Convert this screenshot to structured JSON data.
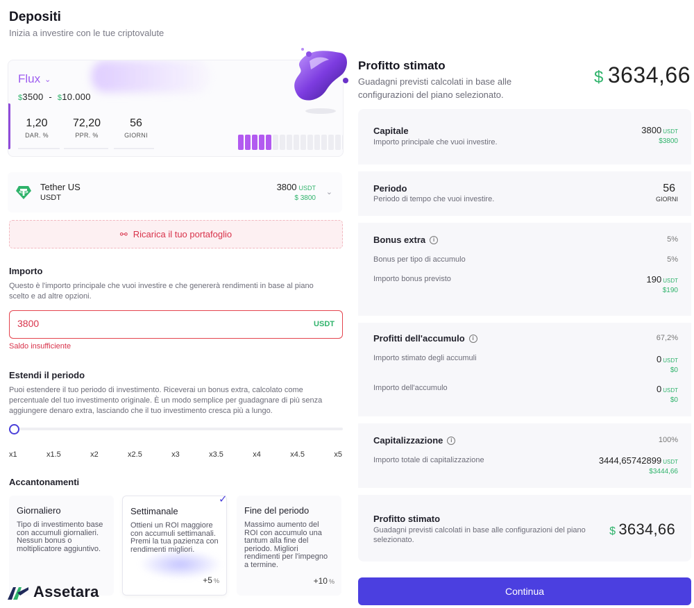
{
  "header": {
    "title": "Depositi",
    "subtitle": "Inizia a investire con le tue criptovalute"
  },
  "plan": {
    "name": "Flux",
    "range_min_currency": "$",
    "range_min": "3500",
    "range_sep": "-",
    "range_max_currency": "$",
    "range_max": "10.000",
    "stats": [
      {
        "value": "1,20",
        "label": "DAR. %"
      },
      {
        "value": "72,20",
        "label": "PPR. %"
      },
      {
        "value": "56",
        "label": "GIORNI"
      }
    ],
    "level_filled": 5,
    "level_total": 16,
    "accent_color": "#b25af0"
  },
  "wallet": {
    "name": "Tether US",
    "symbol": "USDT",
    "amount": "3800",
    "amount_unit": "USDT",
    "amount_usd": "$ 3800"
  },
  "alert": {
    "label": "Ricarica il tuo portafoglio",
    "color": "#d8324a"
  },
  "importo": {
    "title": "Importo",
    "description": "Questo è l'importo principale che vuoi investire e che genererà rendimenti in base al piano scelto e ad altre opzioni.",
    "value": "3800",
    "unit": "USDT",
    "error": "Saldo insufficiente"
  },
  "period": {
    "title": "Estendi il periodo",
    "description": "Puoi estendere il tuo periodo di investimento. Riceverai un bonus extra, calcolato come percentuale del tuo investimento originale. È un modo semplice per guadagnare di più senza aggiungere denaro extra, lasciando che il tuo investimento cresca più a lungo.",
    "ticks": [
      "x1",
      "x1.5",
      "x2",
      "x2.5",
      "x3",
      "x3.5",
      "x4",
      "x4.5",
      "x5"
    ],
    "selected": "x1"
  },
  "accruals": {
    "title": "Accantonamenti",
    "options": [
      {
        "title": "Giornaliero",
        "description": "Tipo di investimento base con accumuli giornalieri. Nessun bonus o moltiplicatore aggiuntivo.",
        "bonus": "",
        "bonus_unit": ""
      },
      {
        "title": "Settimanale",
        "description": "Ottieni un ROI maggiore con accumuli settimanali. Premi la tua pazienza con rendimenti migliori.",
        "bonus": "+5",
        "bonus_unit": "%"
      },
      {
        "title": "Fine del periodo",
        "description": "Massimo aumento del ROI con accumulo una tantum alla fine del periodo. Migliori rendimenti per l'impegno a termine.",
        "bonus": "+10",
        "bonus_unit": "%"
      }
    ],
    "selected_index": 1
  },
  "logo": {
    "text": "Assetara"
  },
  "profit": {
    "title": "Profitto stimato",
    "description": "Guadagni previsti calcolati in base alle configurazioni del piano selezionato.",
    "currency": "$",
    "amount": "3634,66"
  },
  "details": {
    "capitale": {
      "title": "Capitale",
      "description": "Importo principale che vuoi investire.",
      "value": "3800",
      "unit": "USDT",
      "usd": "$3800"
    },
    "periodo": {
      "title": "Periodo",
      "description": "Periodo di tempo che vuoi investire.",
      "value": "56",
      "unit": "GIORNI"
    },
    "bonus": {
      "title": "Bonus extra",
      "pct": "5%",
      "type_label": "Bonus per tipo di accumulo",
      "type_pct": "5%",
      "expected_label": "Importo bonus previsto",
      "expected_value": "190",
      "expected_unit": "USDT",
      "expected_usd": "$190"
    },
    "accumulo": {
      "title": "Profitti dell'accumulo",
      "pct": "67,2%",
      "estimated_label": "Importo stimato degli accumuli",
      "estimated_value": "0",
      "estimated_unit": "USDT",
      "estimated_usd": "$0",
      "amount_label": "Importo dell'accumulo",
      "amount_value": "0",
      "amount_unit": "USDT",
      "amount_usd": "$0"
    },
    "capitalizzazione": {
      "title": "Capitalizzazione",
      "pct": "100%",
      "total_label": "Importo totale di capitalizzazione",
      "total_value": "3444,65742899",
      "total_unit": "USDT",
      "total_usd": "$3444,66"
    }
  },
  "summary": {
    "title": "Profitto stimato",
    "description": "Guadagni previsti calcolati in base alle configurazioni del piano selezionato.",
    "currency": "$",
    "amount": "3634,66"
  },
  "continue_label": "Continua",
  "colors": {
    "primary": "#4b3fe0",
    "positive": "#2fb36b",
    "error": "#d8324a"
  }
}
